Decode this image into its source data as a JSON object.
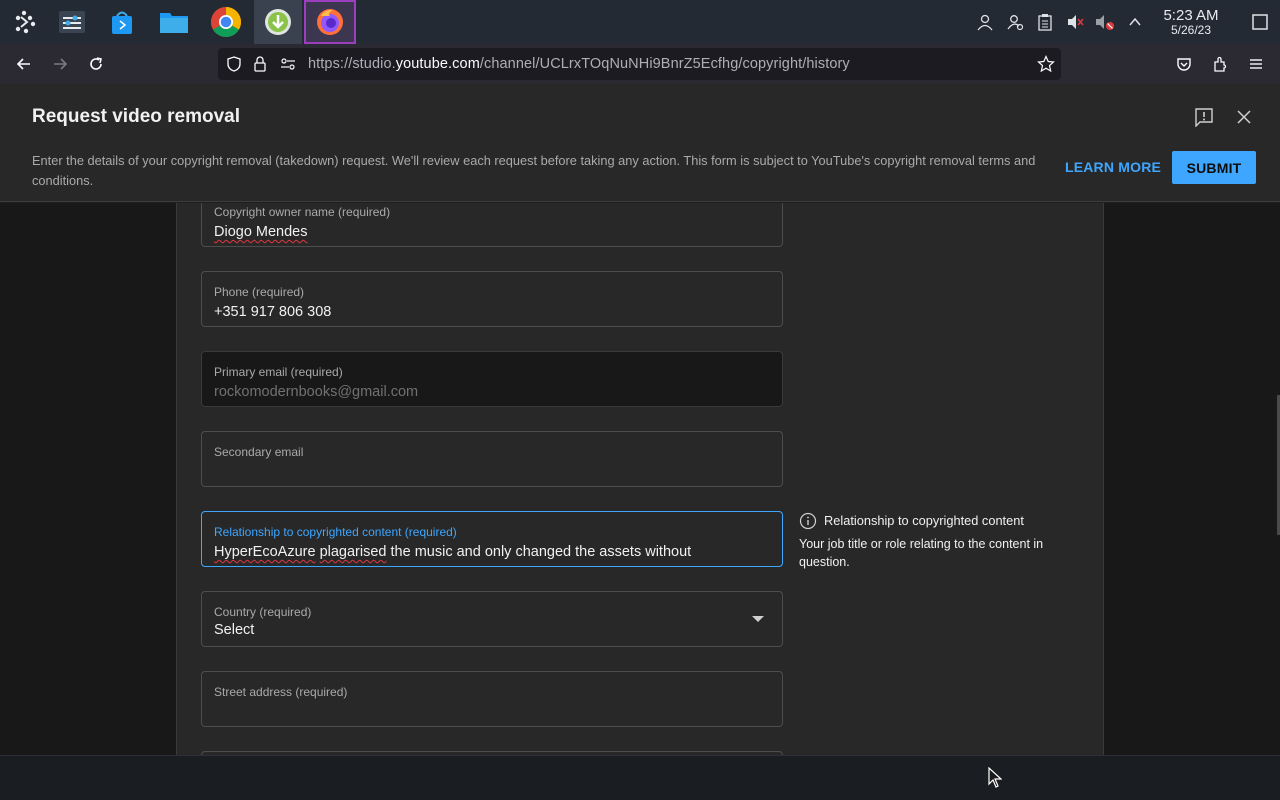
{
  "taskbar": {
    "apps": [
      {
        "name": "launcher"
      },
      {
        "name": "system-settings"
      },
      {
        "name": "discover-store"
      },
      {
        "name": "file-manager"
      },
      {
        "name": "chrome"
      },
      {
        "name": "downloader"
      },
      {
        "name": "firefox"
      }
    ],
    "time": "5:23 AM",
    "date": "5/26/23"
  },
  "browser": {
    "url_prefix": "https://studio.",
    "url_host": "youtube.com",
    "url_path": "/channel/UCLrxTOqNuNHi9BnrZ5Ecfhg/copyright/history"
  },
  "dialog": {
    "title": "Request video removal",
    "description": "Enter the details of your copyright removal (takedown) request. We'll review each request before taking any action. This form is subject to YouTube's copyright removal terms and conditions.",
    "learn_more_label": "LEARN MORE",
    "submit_label": "SUBMIT"
  },
  "form": {
    "owner_name": {
      "label": "Copyright owner name (required)",
      "value": "Diogo Mendes"
    },
    "phone": {
      "label": "Phone (required)",
      "value": "+351 917 806 308"
    },
    "primary_email": {
      "label": "Primary email (required)",
      "value": "rockomodernbooks@gmail.com"
    },
    "secondary_email": {
      "label": "Secondary email",
      "value": ""
    },
    "relationship": {
      "label": "Relationship to copyrighted content (required)",
      "value_word1": "HyperEcoAzure",
      "value_word2": "plagarised",
      "value_rest": " the music and only changed the assets without"
    },
    "country": {
      "label": "Country (required)",
      "value": "Select"
    },
    "street": {
      "label": "Street address (required)",
      "value": ""
    }
  },
  "help": {
    "title": "Relationship to copyrighted content",
    "body": "Your job title or role relating to the content in question."
  },
  "colors": {
    "accent": "#3ea6ff",
    "panel": "#282828",
    "background": "#181818"
  }
}
